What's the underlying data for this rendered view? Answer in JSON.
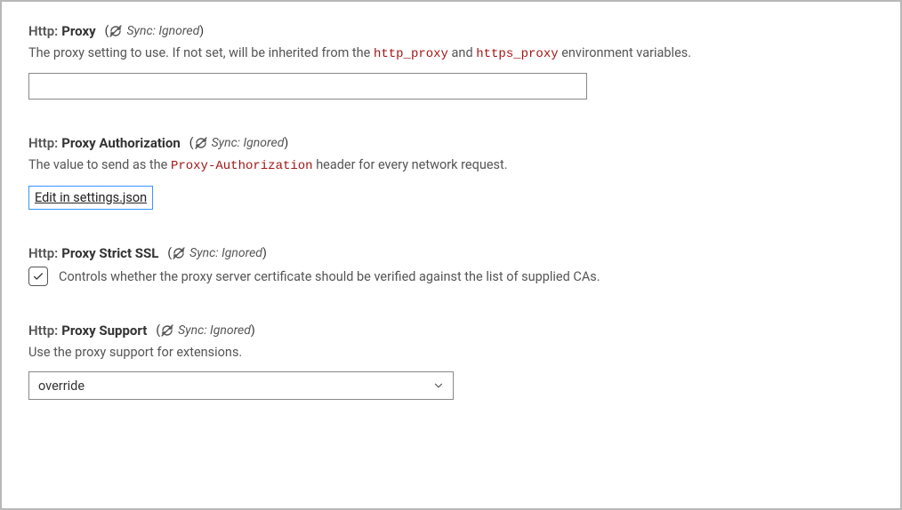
{
  "sync_label": "Sync: Ignored",
  "settings": {
    "proxy": {
      "category": "Http:",
      "title": "Proxy",
      "description_pre": "The proxy setting to use. If not set, will be inherited from the ",
      "code1": "http_proxy",
      "description_mid": " and ",
      "code2": "https_proxy",
      "description_post": " environment variables.",
      "value": ""
    },
    "proxyAuth": {
      "category": "Http:",
      "title": "Proxy Authorization",
      "description_pre": "The value to send as the ",
      "code1": "Proxy-Authorization",
      "description_post": " header for every network request.",
      "edit_link": "Edit in settings.json"
    },
    "proxyStrictSSL": {
      "category": "Http:",
      "title": "Proxy Strict SSL",
      "description": "Controls whether the proxy server certificate should be verified against the list of supplied CAs.",
      "checked": true
    },
    "proxySupport": {
      "category": "Http:",
      "title": "Proxy Support",
      "description": "Use the proxy support for extensions.",
      "value": "override"
    }
  }
}
